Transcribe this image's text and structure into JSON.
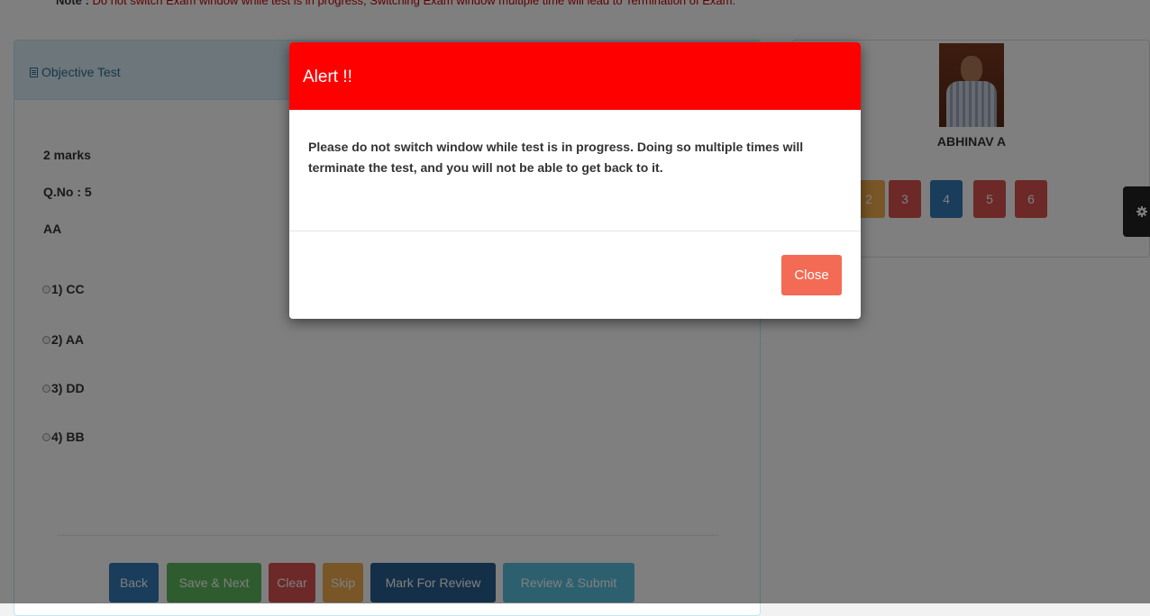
{
  "note": {
    "label": "Note :",
    "text": "Do not switch Exam window while test is in progress, Switching Exam window multiple time will lead to Termination of Exam."
  },
  "left_panel": {
    "title": "Objective Test",
    "marks": "2 marks",
    "qno": "Q.No : 5",
    "question": "AA",
    "options": [
      "1) CC",
      "2) AA",
      "3) DD",
      "4) BB"
    ]
  },
  "actions": {
    "back": "Back",
    "save_next": "Save & Next",
    "clear": "Clear",
    "skip": "Skip",
    "mark_review": "Mark For Review",
    "review_submit": "Review & Submit"
  },
  "candidate": {
    "name": "ABHINAV A"
  },
  "question_palette": [
    "2",
    "3",
    "4",
    "5",
    "6"
  ],
  "modal": {
    "title": "Alert !!",
    "message": "Please do not switch window while test is in progress. Doing so multiple times will terminate the test, and you will not be able to get back to it.",
    "close_label": "Close"
  },
  "colors": {
    "alert_header": "#ff0000",
    "close_button": "#f46b55",
    "answered": "#f0ad4e",
    "not_answered": "#d9534f",
    "current": "#337ab7",
    "save_next": "#5cb85c",
    "review_submit": "#5bc0de"
  }
}
